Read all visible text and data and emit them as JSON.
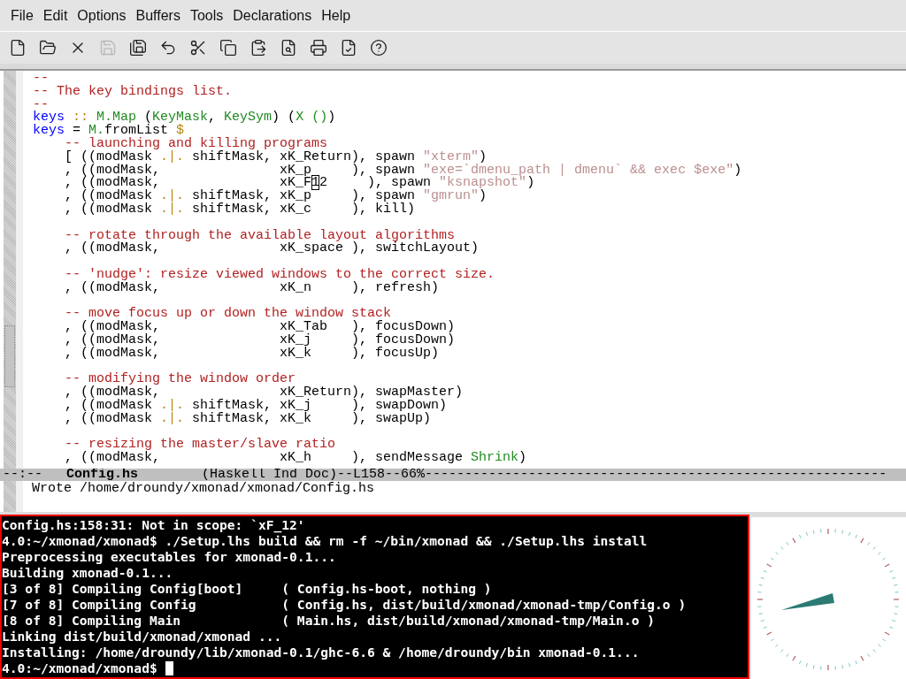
{
  "menu": [
    "File",
    "Edit",
    "Options",
    "Buffers",
    "Tools",
    "Declarations",
    "Help"
  ],
  "toolbar": [
    {
      "disabled": false
    },
    {
      "disabled": false
    },
    {
      "disabled": false
    },
    {
      "disabled": true
    },
    {
      "disabled": false
    },
    {
      "disabled": false
    },
    {
      "disabled": false
    },
    {
      "disabled": false
    },
    {
      "disabled": false
    },
    {
      "disabled": false
    },
    {
      "disabled": false
    },
    {
      "disabled": false
    },
    {
      "disabled": false
    }
  ],
  "editor": {
    "lines": [
      {
        "kind": "code",
        "segments": [
          {
            "kind": "comment",
            "text": "--"
          }
        ]
      },
      {
        "kind": "code",
        "segments": [
          {
            "kind": "comment",
            "text": "-- The key bindings list."
          }
        ]
      },
      {
        "kind": "code",
        "segments": [
          {
            "kind": "comment",
            "text": "--"
          }
        ]
      },
      {
        "kind": "code",
        "segments": [
          {
            "kind": "keyword",
            "text": "keys"
          },
          {
            "kind": "operator",
            "text": " ::"
          },
          {
            "kind": "type",
            "text": " M.Map"
          },
          {
            "kind": "plain",
            "text": " ("
          },
          {
            "kind": "type",
            "text": "KeyMask"
          },
          {
            "kind": "plain",
            "text": ", "
          },
          {
            "kind": "type",
            "text": "KeySym"
          },
          {
            "kind": "plain",
            "text": ") ("
          },
          {
            "kind": "type",
            "text": "X ()"
          },
          {
            "kind": "plain",
            "text": ")"
          }
        ]
      },
      {
        "kind": "code",
        "segments": [
          {
            "kind": "keyword",
            "text": "keys"
          },
          {
            "kind": "plain",
            "text": " = "
          },
          {
            "kind": "type",
            "text": "M."
          },
          {
            "kind": "plain",
            "text": "fromList "
          },
          {
            "kind": "operator",
            "text": "$"
          }
        ]
      },
      {
        "kind": "code",
        "segments": [
          {
            "kind": "comment",
            "text": "    -- launching and killing programs"
          }
        ]
      },
      {
        "kind": "code",
        "segments": [
          {
            "kind": "plain",
            "text": "    [ ((modMask "
          },
          {
            "kind": "operator",
            "text": ".|."
          },
          {
            "kind": "plain",
            "text": " shiftMask, xK_Return), spawn "
          },
          {
            "kind": "string",
            "text": "\"xterm\""
          },
          {
            "kind": "plain",
            "text": ")"
          }
        ]
      },
      {
        "kind": "code",
        "segments": [
          {
            "kind": "plain",
            "text": "    , ((modMask,               xK_p     ), spawn "
          },
          {
            "kind": "string",
            "text": "\"exe=`dmenu_path | dmenu` && exec $exe\""
          },
          {
            "kind": "plain",
            "text": ")"
          }
        ]
      },
      {
        "kind": "code",
        "segments": [
          {
            "kind": "plain",
            "text": "    , ((modMask,               xK_F"
          },
          {
            "kind": "cursor",
            "text": "1"
          },
          {
            "kind": "plain",
            "text": "2     ), spawn "
          },
          {
            "kind": "string",
            "text": "\"ksnapshot\""
          },
          {
            "kind": "plain",
            "text": ")"
          }
        ]
      },
      {
        "kind": "code",
        "segments": [
          {
            "kind": "plain",
            "text": "    , ((modMask "
          },
          {
            "kind": "operator",
            "text": ".|."
          },
          {
            "kind": "plain",
            "text": " shiftMask, xK_p     ), spawn "
          },
          {
            "kind": "string",
            "text": "\"gmrun\""
          },
          {
            "kind": "plain",
            "text": ")"
          }
        ]
      },
      {
        "kind": "code",
        "segments": [
          {
            "kind": "plain",
            "text": "    , ((modMask "
          },
          {
            "kind": "operator",
            "text": ".|."
          },
          {
            "kind": "plain",
            "text": " shiftMask, xK_c     ), kill)"
          }
        ]
      },
      {
        "kind": "blank"
      },
      {
        "kind": "code",
        "segments": [
          {
            "kind": "comment",
            "text": "    -- rotate through the available layout algorithms"
          }
        ]
      },
      {
        "kind": "code",
        "segments": [
          {
            "kind": "plain",
            "text": "    , ((modMask,               xK_space ), switchLayout)"
          }
        ]
      },
      {
        "kind": "blank"
      },
      {
        "kind": "code",
        "segments": [
          {
            "kind": "comment",
            "text": "    -- 'nudge': resize viewed windows to the correct size."
          }
        ]
      },
      {
        "kind": "code",
        "segments": [
          {
            "kind": "plain",
            "text": "    , ((modMask,               xK_n     ), refresh)"
          }
        ]
      },
      {
        "kind": "blank"
      },
      {
        "kind": "code",
        "segments": [
          {
            "kind": "comment",
            "text": "    -- move focus up or down the window stack"
          }
        ]
      },
      {
        "kind": "code",
        "segments": [
          {
            "kind": "plain",
            "text": "    , ((modMask,               xK_Tab   ), focusDown)"
          }
        ]
      },
      {
        "kind": "code",
        "segments": [
          {
            "kind": "plain",
            "text": "    , ((modMask,               xK_j     ), focusDown)"
          }
        ]
      },
      {
        "kind": "code",
        "segments": [
          {
            "kind": "plain",
            "text": "    , ((modMask,               xK_k     ), focusUp)"
          }
        ]
      },
      {
        "kind": "blank"
      },
      {
        "kind": "code",
        "segments": [
          {
            "kind": "comment",
            "text": "    -- modifying the window order"
          }
        ]
      },
      {
        "kind": "code",
        "segments": [
          {
            "kind": "plain",
            "text": "    , ((modMask,               xK_Return), swapMaster)"
          }
        ]
      },
      {
        "kind": "code",
        "segments": [
          {
            "kind": "plain",
            "text": "    , ((modMask "
          },
          {
            "kind": "operator",
            "text": ".|."
          },
          {
            "kind": "plain",
            "text": " shiftMask, xK_j     ), swapDown)"
          }
        ]
      },
      {
        "kind": "code",
        "segments": [
          {
            "kind": "plain",
            "text": "    , ((modMask "
          },
          {
            "kind": "operator",
            "text": ".|."
          },
          {
            "kind": "plain",
            "text": " shiftMask, xK_k     ), swapUp)"
          }
        ]
      },
      {
        "kind": "blank"
      },
      {
        "kind": "code",
        "segments": [
          {
            "kind": "comment",
            "text": "    -- resizing the master/slave ratio"
          }
        ]
      },
      {
        "kind": "code",
        "segments": [
          {
            "kind": "plain",
            "text": "    , ((modMask,               xK_h     ), sendMessage "
          },
          {
            "kind": "type",
            "text": "Shrink"
          },
          {
            "kind": "plain",
            "text": ")"
          }
        ]
      }
    ]
  },
  "mode_line": {
    "status": "--:--",
    "buffer": "Config.hs",
    "info": "(Haskell Ind Doc)--L158--66%----------------------------------------------------------"
  },
  "minibuffer": "Wrote /home/droundy/xmonad/xmonad/Config.hs",
  "terminal": {
    "lines": [
      "Config.hs:158:31: Not in scope: `xF_12'",
      "4.0:~/xmonad/xmonad$ ./Setup.lhs build && rm -f ~/bin/xmonad && ./Setup.lhs install",
      "Preprocessing executables for xmonad-0.1...",
      "Building xmonad-0.1...",
      "[3 of 8] Compiling Config[boot]     ( Config.hs-boot, nothing )",
      "[7 of 8] Compiling Config           ( Config.hs, dist/build/xmonad/xmonad-tmp/Config.o )",
      "[8 of 8] Compiling Main             ( Main.hs, dist/build/xmonad/xmonad-tmp/Main.o )",
      "Linking dist/build/xmonad/xmonad ...",
      "Installing: /home/droundy/lib/xmonad-0.1/ghc-6.6 & /home/droundy/bin xmonad-0.1..."
    ],
    "prompt": {
      "text": "4.0:~/xmonad/xmonad$ ",
      "cursor": true
    }
  }
}
